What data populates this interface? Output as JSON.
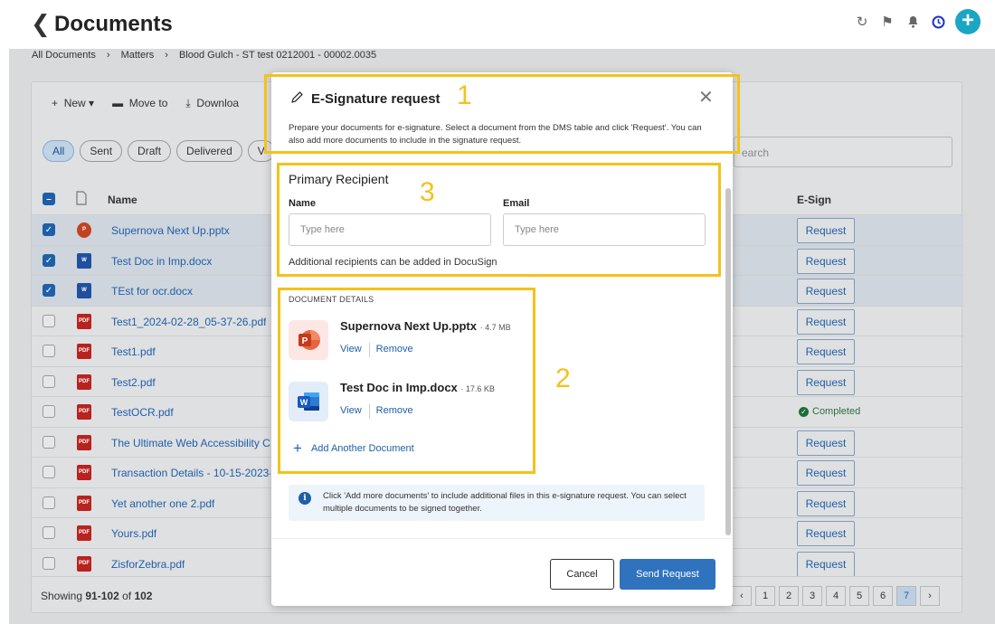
{
  "header": {
    "title": "Documents"
  },
  "breadcrumb": [
    "All Documents",
    "Matters",
    "Blood Gulch - ST test 0212001 - 00002.0035"
  ],
  "toolbar": {
    "new": "New",
    "move_to": "Move to",
    "download": "Downloa"
  },
  "filters": [
    "All",
    "Sent",
    "Draft",
    "Delivered",
    "V"
  ],
  "search_placeholder": "earch",
  "table": {
    "col_name": "Name",
    "col_esign": "E-Sign",
    "request_label": "Request",
    "completed_label": "Completed",
    "rows": [
      {
        "name": "Supernova Next Up.pptx",
        "type": "ppt",
        "checked": true
      },
      {
        "name": "Test Doc in Imp.docx",
        "type": "doc",
        "checked": true
      },
      {
        "name": "TEst for ocr.docx",
        "type": "doc",
        "checked": true
      },
      {
        "name": "Test1_2024-02-28_05-37-26.pdf",
        "type": "pdf",
        "checked": false
      },
      {
        "name": "Test1.pdf",
        "type": "pdf",
        "checked": false
      },
      {
        "name": "Test2.pdf",
        "type": "pdf",
        "checked": false
      },
      {
        "name": "TestOCR.pdf",
        "type": "pdf",
        "checked": false,
        "completed": true
      },
      {
        "name": "The Ultimate Web Accessibility Ch",
        "type": "pdf",
        "checked": false
      },
      {
        "name": "Transaction Details - 10-15-2023-",
        "type": "pdf",
        "checked": false
      },
      {
        "name": "Yet another one 2.pdf",
        "type": "pdf",
        "checked": false
      },
      {
        "name": "Yours.pdf",
        "type": "pdf",
        "checked": false
      },
      {
        "name": "ZisforZebra.pdf",
        "type": "pdf",
        "checked": false
      }
    ]
  },
  "pagination": {
    "showing_prefix": "Showing",
    "range": "91-102",
    "of": "of",
    "total": "102",
    "pages": [
      "‹",
      "1",
      "2",
      "3",
      "4",
      "5",
      "6",
      "7",
      "›"
    ],
    "active_page": "7"
  },
  "modal": {
    "title": "E-Signature request",
    "description": "Prepare your documents for e-signature. Select a document from the DMS table and click 'Request'. You can also add more documents to include in the signature request.",
    "primary_recipient": {
      "title": "Primary Recipient",
      "name_label": "Name",
      "email_label": "Email",
      "name_placeholder": "Type here",
      "email_placeholder": "Type here",
      "note": "Additional recipients can be added in DocuSign"
    },
    "document_details": {
      "title": "DOCUMENT DETAILS",
      "docs": [
        {
          "name": "Supernova Next Up.pptx",
          "size": "· 4.7 MB",
          "view": "View",
          "remove": "Remove"
        },
        {
          "name": "Test Doc in Imp.docx",
          "size": "· 17.6 KB",
          "view": "View",
          "remove": "Remove"
        }
      ],
      "add_label": "Add Another Document"
    },
    "info": "Click 'Add more documents' to include additional files in this e-signature request. You can select multiple documents to be signed together.",
    "cancel": "Cancel",
    "send": "Send Request"
  },
  "annotations": [
    "1",
    "2",
    "3"
  ],
  "colors": {
    "accent": "#2f73be",
    "annotation": "#f3c21b",
    "brand_plus": "#1aa6c4"
  }
}
